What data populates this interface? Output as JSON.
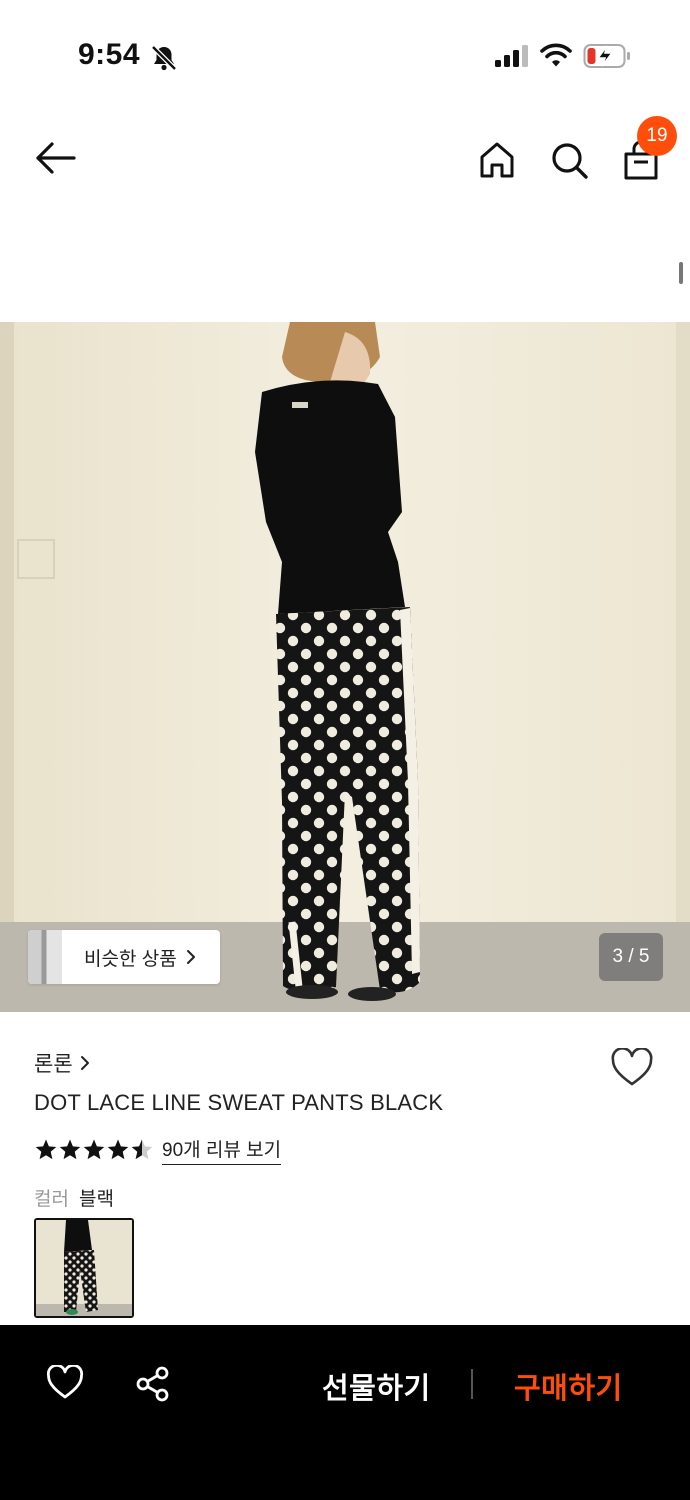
{
  "status_bar": {
    "time": "9:54",
    "icons": [
      "bell-off-icon",
      "signal-icon",
      "wifi-icon",
      "battery-charging-icon"
    ]
  },
  "header": {
    "icons": [
      "arrow-left-icon",
      "home-icon",
      "search-icon",
      "shopping-bag-icon"
    ],
    "cart_count": "19"
  },
  "gallery": {
    "similar_label": "비슷한 상품",
    "page_counter": "3 / 5"
  },
  "product": {
    "brand": "론론",
    "title": "DOT LACE LINE SWEAT PANTS BLACK",
    "rating": 4.5,
    "review_link": "90개 리뷰 보기",
    "color_label": "컬러",
    "color_value": "블랙"
  },
  "bottom_bar": {
    "gift_label": "선물하기",
    "buy_label": "구매하기",
    "icons": [
      "heart-icon",
      "share-icon"
    ]
  },
  "colors": {
    "accent": "#ff4d0c",
    "bottom_bar_bg": "#000000",
    "photo_wall": "#efe9d6"
  }
}
